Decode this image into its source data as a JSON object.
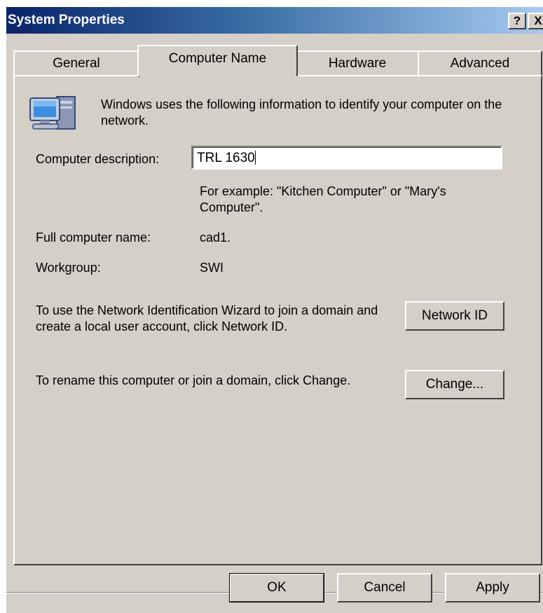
{
  "window": {
    "title": "System Properties",
    "help_label": "?",
    "close_label": "X"
  },
  "tabs": [
    {
      "label": "General",
      "active": false
    },
    {
      "label": "Computer Name",
      "active": true
    },
    {
      "label": "Hardware",
      "active": false
    },
    {
      "label": "Advanced",
      "active": false
    }
  ],
  "panel": {
    "intro_text": "Windows uses the following information to identify your computer on the network.",
    "description_label": "Computer description:",
    "description_value": "TRL 1630",
    "example_text": "For example: \"Kitchen Computer\" or \"Mary's Computer\".",
    "full_name_label": "Full computer name:",
    "full_name_value": "cad1.",
    "workgroup_label": "Workgroup:",
    "workgroup_value": "SWI",
    "network_id_text": "To use the Network Identification Wizard to join a domain and create a local user account, click Network ID.",
    "network_id_button": "Network ID",
    "rename_text": "To rename this computer or join a domain, click Change.",
    "change_button": "Change..."
  },
  "footer": {
    "ok_label": "OK",
    "cancel_label": "Cancel",
    "apply_label": "Apply"
  },
  "icons": {
    "computer": "computer-icon"
  },
  "colors": {
    "dialog_bg": "#d4d0c8",
    "title_start": "#0a246a",
    "title_end": "#a6caf0"
  }
}
